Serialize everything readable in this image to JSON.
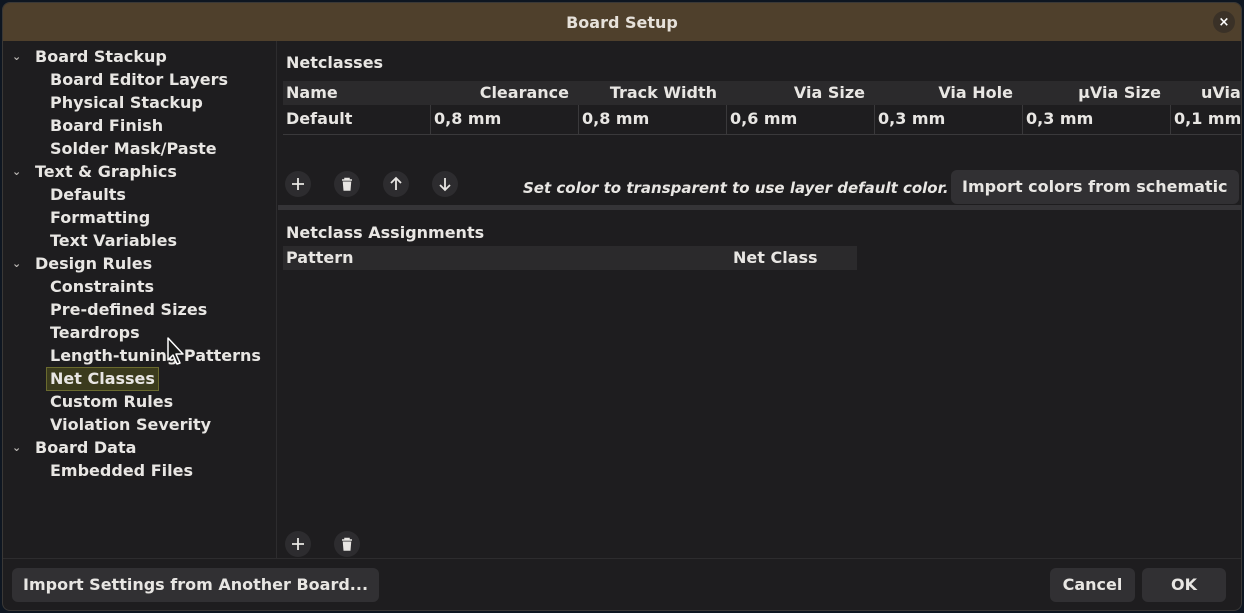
{
  "window": {
    "title": "Board Setup",
    "close_glyph": "×"
  },
  "sidebar": {
    "groups": [
      {
        "label": "Board Stackup",
        "children": [
          "Board Editor Layers",
          "Physical Stackup",
          "Board Finish",
          "Solder Mask/Paste"
        ]
      },
      {
        "label": "Text & Graphics",
        "children": [
          "Defaults",
          "Formatting",
          "Text Variables"
        ]
      },
      {
        "label": "Design Rules",
        "children": [
          "Constraints",
          "Pre-defined Sizes",
          "Teardrops",
          "Length-tuning Patterns",
          "Net Classes",
          "Custom Rules",
          "Violation Severity"
        ]
      },
      {
        "label": "Board Data",
        "children": [
          "Embedded Files"
        ]
      }
    ],
    "selected": "Net Classes",
    "chevron": "⌄"
  },
  "netclasses": {
    "title": "Netclasses",
    "columns": [
      "Name",
      "Clearance",
      "Track Width",
      "Via Size",
      "Via Hole",
      "µVia Size",
      "uVia"
    ],
    "rows": [
      {
        "name": "Default",
        "clearance": "0,8 mm",
        "track_width": "0,8 mm",
        "via_size": "0,6 mm",
        "via_hole": "0,3 mm",
        "uvia_size": "0,3 mm",
        "uvia": "0,1 mm"
      }
    ],
    "hint": "Set color to transparent to use layer default color.",
    "import_colors_label": "Import colors from schematic"
  },
  "assignments": {
    "title": "Netclass Assignments",
    "columns": [
      "Pattern",
      "Net Class"
    ]
  },
  "footer": {
    "import_settings_label": "Import Settings from Another Board...",
    "cancel_label": "Cancel",
    "ok_label": "OK"
  },
  "icons": [
    "plus-icon",
    "trash-icon",
    "arrow-up-icon",
    "arrow-down-icon",
    "close-icon",
    "chevron-down-icon",
    "mouse-cursor-icon"
  ],
  "colors": {
    "titlebar": "#4f402c",
    "selection": "#3b3b1d",
    "background": "#1e1d1f"
  }
}
